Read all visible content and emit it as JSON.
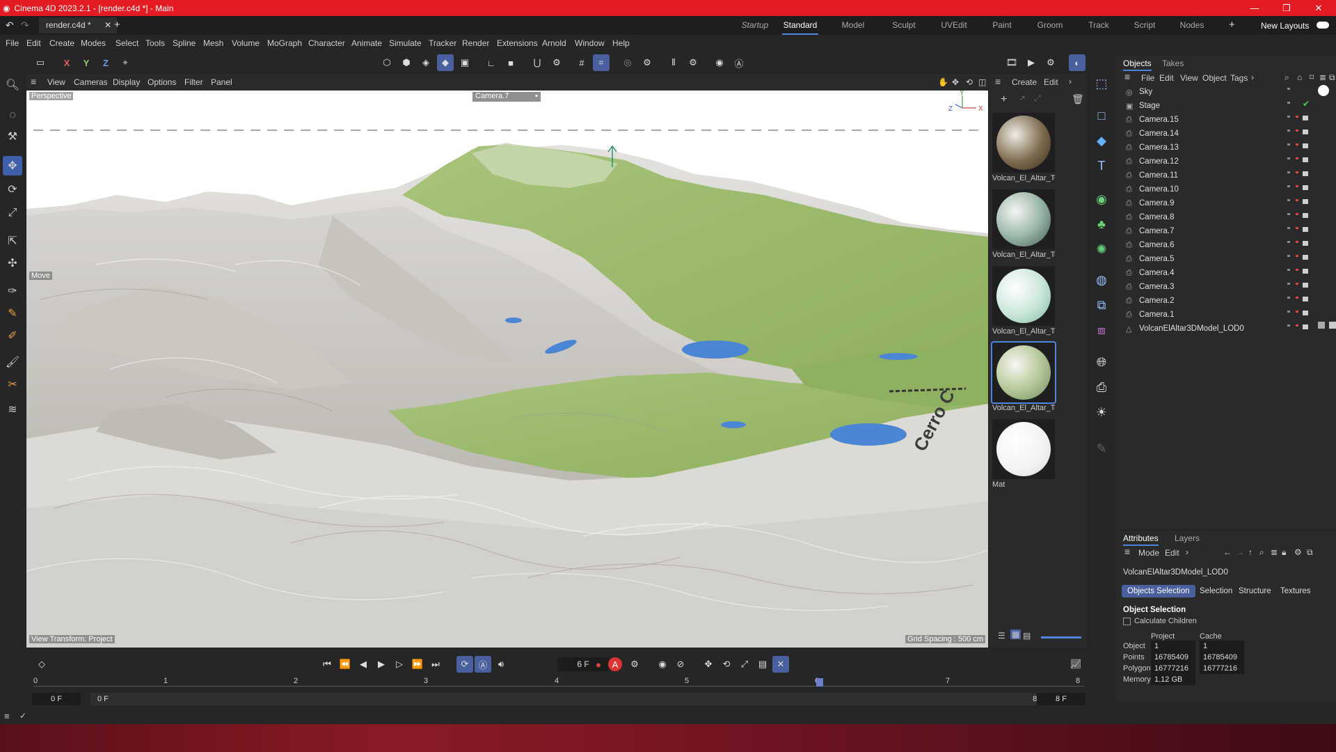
{
  "app": {
    "window_title": "Cinema 4D 2023.2.1 - [render.c4d *] - Main",
    "doc_tab": "render.c4d *",
    "layouts": [
      "Startup",
      "Standard",
      "Model",
      "Sculpt",
      "UVEdit",
      "Paint",
      "Groom",
      "Track",
      "Script",
      "Nodes"
    ],
    "active_layout": "Standard",
    "new_layouts_label": "New Layouts"
  },
  "menu": [
    "File",
    "Edit",
    "Create",
    "Modes",
    "Select",
    "Tools",
    "Spline",
    "Mesh",
    "Volume",
    "MoGraph",
    "Character",
    "Animate",
    "Simulate",
    "Tracker",
    "Render",
    "Extensions",
    "Arnold",
    "Window",
    "Help"
  ],
  "toolbar": {
    "axis_x": "X",
    "axis_y": "Y",
    "axis_z": "Z"
  },
  "viewport": {
    "menu": [
      "View",
      "Cameras",
      "Display",
      "Options",
      "Filter",
      "Panel"
    ],
    "view_name": "Perspective",
    "camera_label": "Camera.7",
    "tool_label": "Move",
    "terrain_label": "Cerro C",
    "view_transform": "View Transform: Project",
    "grid_spacing": "Grid Spacing : 500 cm",
    "axis_labels": {
      "x": "X",
      "y": "Y",
      "z": "Z"
    }
  },
  "materials": {
    "menu": [
      "Create",
      "Edit"
    ],
    "items": [
      {
        "label": "Volcan_El_Altar_Te",
        "gradient": "radial-gradient(circle at 35% 35%, #f0ece4, #7b6a4e 55%, #3a2f20)"
      },
      {
        "label": "Volcan_El_Altar_Te",
        "gradient": "radial-gradient(circle at 35% 35%, #f4f6f4, #9db9a9 50%, #3f5b50)"
      },
      {
        "label": "Volcan_El_Altar_Te",
        "gradient": "radial-gradient(circle at 35% 35%, #ffffff, #c9e6d8 55%, #7db7a2)"
      },
      {
        "label": "Volcan_El_Altar_Te",
        "gradient": "radial-gradient(circle at 35% 35%, #f7f7f2, #b7ca9b 50%, #6f8c62)"
      },
      {
        "label": "Mat",
        "gradient": "radial-gradient(circle at 35% 35%, #ffffff, #f2f2f2 60%, #d9d9d9)"
      }
    ],
    "selected_index": 3
  },
  "objects": {
    "tabs": [
      "Objects",
      "Takes"
    ],
    "menu": [
      "File",
      "Edit",
      "View",
      "Object",
      "Tags"
    ],
    "items": [
      "Sky",
      "Stage",
      "Camera.15",
      "Camera.14",
      "Camera.13",
      "Camera.12",
      "Camera.11",
      "Camera.10",
      "Camera.9",
      "Camera.8",
      "Camera.7",
      "Camera.6",
      "Camera.5",
      "Camera.4",
      "Camera.3",
      "Camera.2",
      "Camera.1",
      "VolcanElAltar3DModel_LOD0"
    ]
  },
  "attributes": {
    "tabs": [
      "Attributes",
      "Layers"
    ],
    "menu": [
      "Mode",
      "Edit"
    ],
    "object_name": "VolcanElAltar3DModel_LOD0",
    "buttons": [
      "Objects Selection",
      "Selection",
      "Structure",
      "Textures"
    ],
    "section_title": "Object Selection",
    "calc_children": "Calculate Children",
    "col_project": "Project",
    "col_cache": "Cache",
    "rows": [
      {
        "label": "Object",
        "project": "1",
        "cache": "1"
      },
      {
        "label": "Points",
        "project": "16785409",
        "cache": "16785409"
      },
      {
        "label": "Polygons",
        "project": "16777216",
        "cache": "16777216"
      },
      {
        "label": "Memory",
        "project": "1.12 GB",
        "cache": ""
      }
    ]
  },
  "timeline": {
    "current_frame": "6 F",
    "ticks": [
      "0",
      "1",
      "2",
      "3",
      "4",
      "5",
      "6",
      "7",
      "8"
    ],
    "start": "0 F",
    "range_start": "0 F",
    "range_end": "8 F",
    "end": "8 F"
  },
  "colors": {
    "accent": "#4f83e0",
    "title_bar": "#e31b23",
    "terrain_green": "#9cbc6a",
    "lake_blue": "#4a86d4"
  }
}
